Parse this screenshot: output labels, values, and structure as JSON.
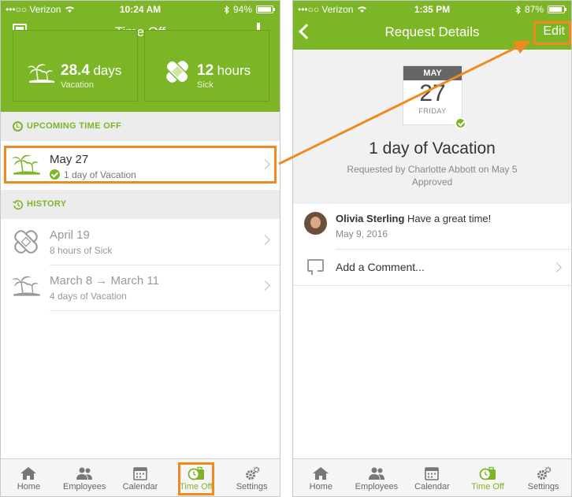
{
  "colors": {
    "brand_green": "#7cb526",
    "highlight_orange": "#f08a1e"
  },
  "left_screen": {
    "status_bar": {
      "carrier": "•••○○ Verizon",
      "time": "10:24 AM",
      "battery": "94%",
      "battery_level": 0.94
    },
    "header": {
      "title": "Time Off",
      "left_icon": "calculator-icon",
      "right_icon": "plus-icon"
    },
    "balances": [
      {
        "value": "28.4",
        "unit": "days",
        "type": "Vacation",
        "icon": "palm-tree-icon"
      },
      {
        "value": "12",
        "unit": "hours",
        "type": "Sick",
        "icon": "bandage-icon"
      }
    ],
    "upcoming": {
      "heading": "UPCOMING TIME OFF",
      "items": [
        {
          "title": "May 27",
          "subtitle": "1 day of Vacation",
          "status": "approved"
        }
      ]
    },
    "history": {
      "heading": "HISTORY",
      "items": [
        {
          "title": "April 19",
          "subtitle": "8 hours of Sick",
          "icon": "bandage-icon"
        },
        {
          "title": "March 8 → March 11",
          "subtitle": "4 days of Vacation",
          "icon": "palm-tree-icon"
        }
      ]
    }
  },
  "right_screen": {
    "status_bar": {
      "carrier": "•••○○ Verizon",
      "time": "1:35 PM",
      "battery": "87%",
      "battery_level": 0.87
    },
    "header": {
      "title": "Request Details",
      "edit_label": "Edit"
    },
    "calendar": {
      "month": "MAY",
      "day": "27",
      "weekday": "FRIDAY"
    },
    "headline": "1 day of Vacation",
    "requested_by": "Requested by Charlotte Abbott on May 5",
    "status": "Approved",
    "comment": {
      "author": "Olivia Sterling",
      "text": "Have a great time!",
      "date": "May 9, 2016"
    },
    "add_comment_label": "Add a Comment..."
  },
  "tabbar": {
    "tabs": [
      {
        "label": "Home",
        "icon": "home-icon"
      },
      {
        "label": "Employees",
        "icon": "people-icon"
      },
      {
        "label": "Calendar",
        "icon": "calendar-icon"
      },
      {
        "label": "Time Off",
        "icon": "clock-suitcase-icon",
        "active": true
      },
      {
        "label": "Settings",
        "icon": "gear-icon"
      }
    ]
  }
}
